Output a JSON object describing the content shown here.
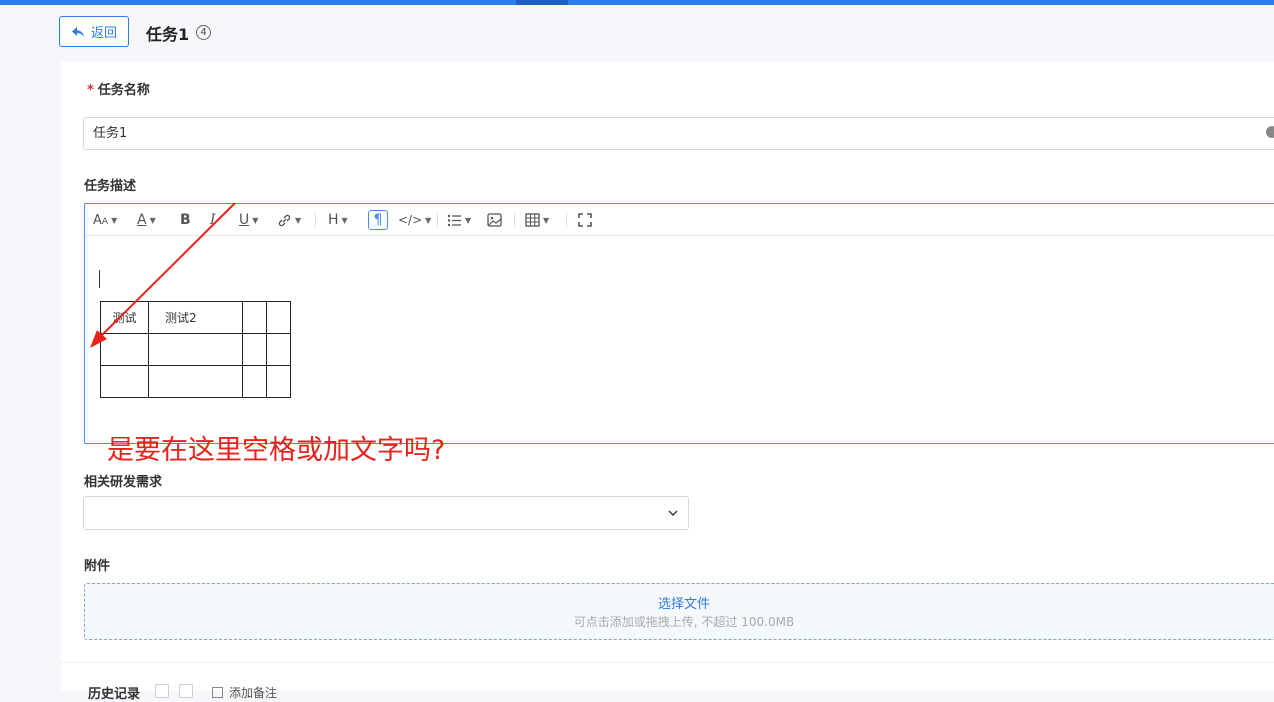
{
  "header": {
    "back_label": "返回",
    "title": "任务1",
    "count": "4"
  },
  "form": {
    "name_label": "任务名称",
    "required_mark": "*",
    "name_value": "任务1",
    "desc_label": "任务描述",
    "req_label": "相关研发需求",
    "attach_label": "附件"
  },
  "editor": {
    "table": [
      [
        "测试",
        "测试2",
        "",
        ""
      ],
      [
        "",
        "",
        "",
        ""
      ],
      [
        "",
        "",
        "",
        ""
      ]
    ]
  },
  "upload": {
    "main": "选择文件",
    "hint": "可点击添加或拖拽上传, 不超过 100.0MB"
  },
  "history": {
    "label": "历史记录",
    "add_note": "添加备注"
  },
  "annotation": {
    "text": "是要在这里空格或加文字吗?",
    "color": "#e8231d"
  },
  "colors": {
    "accent": "#2e7ce6"
  }
}
